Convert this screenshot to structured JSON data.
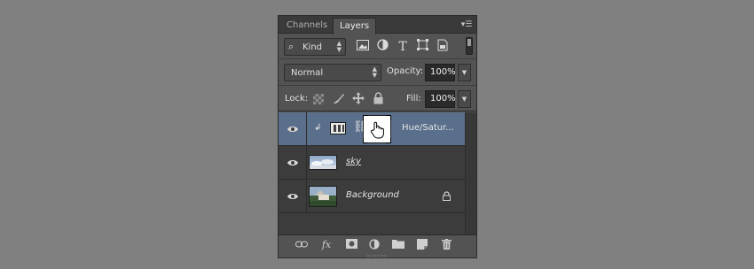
{
  "tabs": [
    {
      "label": "Channels",
      "active": false
    },
    {
      "label": "Layers",
      "active": true
    }
  ],
  "panel_menu_icon": "panel-menu-icon",
  "filter": {
    "search_icon": "⌕",
    "kind_label": "Kind",
    "icons": [
      "image-filter-icon",
      "adjustment-filter-icon",
      "type-filter-icon",
      "shape-filter-icon",
      "smart-object-filter-icon"
    ],
    "type_glyph": "T"
  },
  "blend": {
    "mode": "Normal",
    "opacity_label": "Opacity:",
    "opacity_value": "100%"
  },
  "lock": {
    "label": "Lock:",
    "fill_label": "Fill:",
    "fill_value": "100%"
  },
  "layers": [
    {
      "name": "Hue/Satur...",
      "type": "adjustment",
      "selected": true,
      "clipped": true,
      "locked": false
    },
    {
      "name": "sky",
      "type": "pixel",
      "selected": false,
      "clipped": false,
      "locked": false
    },
    {
      "name": "Background",
      "type": "pixel",
      "selected": false,
      "clipped": false,
      "locked": true
    }
  ],
  "bottom_icons": [
    "link-layers-icon",
    "fx-icon",
    "add-mask-icon",
    "new-adjustment-icon",
    "new-group-icon",
    "new-layer-icon",
    "delete-layer-icon"
  ],
  "bottom_fx": "fx",
  "colors": {
    "background": "#808080",
    "panel": "#535353",
    "selected_layer": "#5a6f8b"
  }
}
